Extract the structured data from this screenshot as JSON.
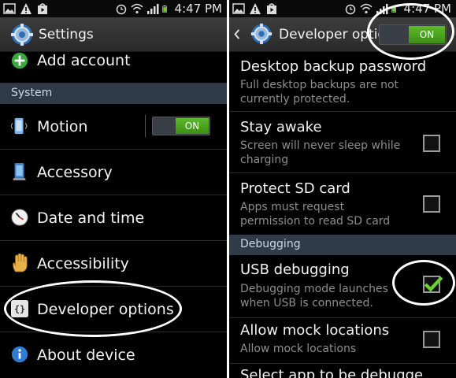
{
  "statusbar": {
    "time": "4:47 PM"
  },
  "left": {
    "title": "Settings",
    "top_item": "Add account",
    "section": "System",
    "items": [
      {
        "label": "Motion",
        "toggle": "ON"
      },
      {
        "label": "Accessory"
      },
      {
        "label": "Date and time"
      },
      {
        "label": "Accessibility"
      },
      {
        "label": "Developer options"
      },
      {
        "label": "About device"
      }
    ]
  },
  "right": {
    "title": "Developer optio",
    "master_toggle": "ON",
    "prefs": [
      {
        "title": "Desktop backup password",
        "summary": "Full desktop backups are not currently protected."
      },
      {
        "title": "Stay awake",
        "summary": "Screen will never sleep while charging",
        "checked": false
      },
      {
        "title": "Protect SD card",
        "summary": "Apps must request permission to read SD card",
        "checked": false
      }
    ],
    "section": "Debugging",
    "debug_prefs": [
      {
        "title": "USB debugging",
        "summary": "Debugging mode launches when USB is connected.",
        "checked": true
      },
      {
        "title": "Allow mock locations",
        "summary": "Allow mock locations",
        "checked": false
      },
      {
        "title": "Select app to be debugge"
      }
    ]
  },
  "colors": {
    "accent_green": "#4caf1f",
    "section_bg": "#2f3b47",
    "summary_gray": "#8d8d8d"
  }
}
